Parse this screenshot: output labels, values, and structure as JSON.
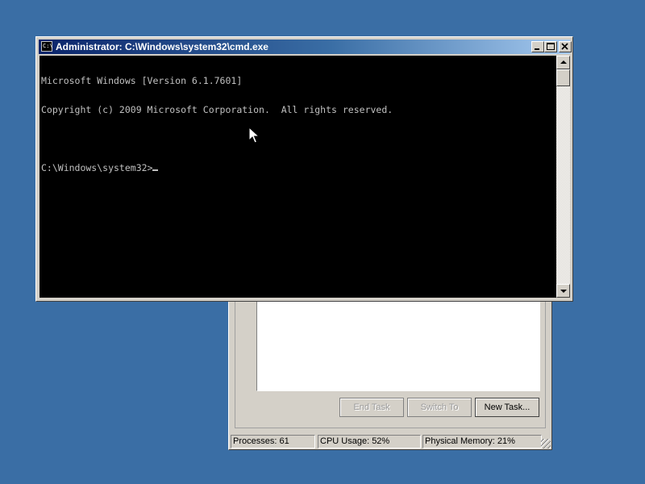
{
  "cmd_window": {
    "title": "Administrator: C:\\Windows\\system32\\cmd.exe",
    "icon_label": "C:\\",
    "buttons": {
      "minimize": "_",
      "maximize": "□",
      "close": "✕"
    },
    "console_lines": [
      "Microsoft Windows [Version 6.1.7601]",
      "Copyright (c) 2009 Microsoft Corporation.  All rights reserved.",
      "",
      "C:\\Windows\\system32>"
    ]
  },
  "task_manager": {
    "buttons": {
      "end_task": "End Task",
      "switch_to": "Switch To",
      "new_task": "New Task..."
    },
    "status": {
      "processes": "Processes: 61",
      "cpu_usage": "CPU Usage: 52%",
      "physical_memory": "Physical Memory: 21%"
    }
  },
  "colors": {
    "desktop": "#3a6ea5",
    "console_bg": "#000000",
    "console_text": "#c0c0c0",
    "window_face": "#d4d0c8"
  }
}
